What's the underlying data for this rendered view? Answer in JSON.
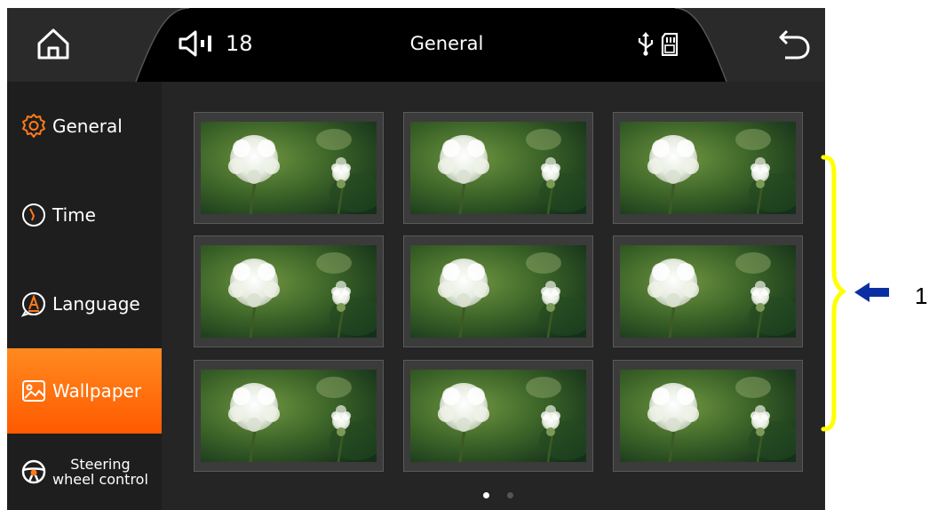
{
  "header": {
    "home_icon": "home-icon",
    "volume_icon": "speaker-icon",
    "volume_value": "18",
    "title": "General",
    "usb_icon": "usb-icon",
    "sd_icon": "sd-card-icon",
    "back_icon": "back-arrow-icon"
  },
  "sidebar": {
    "items": [
      {
        "label": "General",
        "icon": "gear-icon",
        "active": false
      },
      {
        "label": "Time",
        "icon": "clock-icon",
        "active": false
      },
      {
        "label": "Language",
        "icon": "language-icon",
        "active": false
      },
      {
        "label": "Wallpaper",
        "icon": "image-icon",
        "active": true
      },
      {
        "label_line1": "Steering",
        "label_line2": "wheel control",
        "icon": "steering-wheel-icon",
        "active": false
      }
    ]
  },
  "wallpapers": {
    "count": 9,
    "page": 1,
    "pages": 2
  },
  "annotation": {
    "label": "1",
    "bracket_color": "#ffff00",
    "arrow_color": "#0b2fa3"
  },
  "colors": {
    "accent": "#ff6a00",
    "background": "#1b1b1b"
  }
}
